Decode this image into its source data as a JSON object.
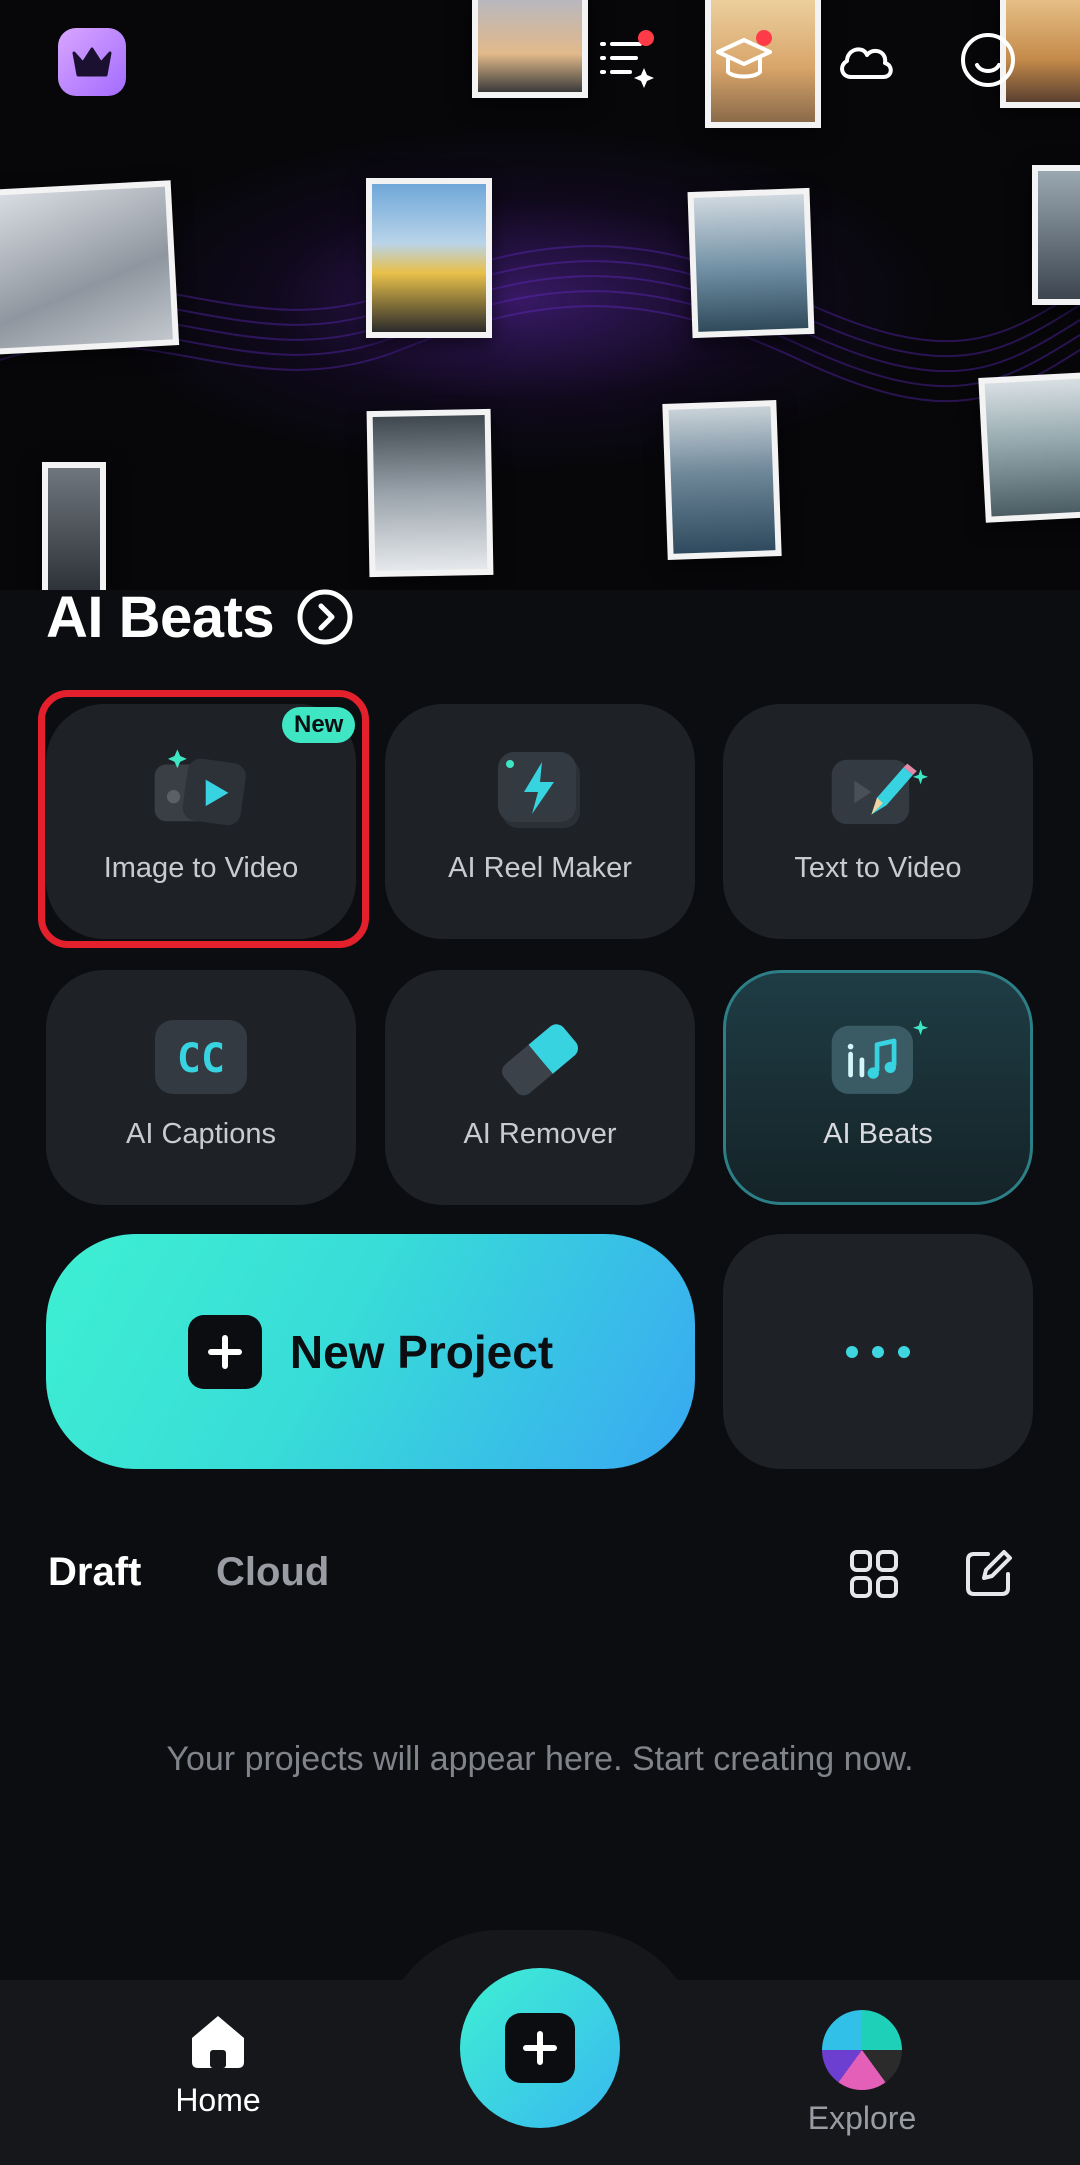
{
  "section": {
    "title": "AI Beats"
  },
  "tools": [
    {
      "label": "Image to Video",
      "badge": "New",
      "icon": "image-to-video-icon"
    },
    {
      "label": "AI Reel Maker",
      "icon": "lightning-icon"
    },
    {
      "label": "Text to Video",
      "icon": "pencil-video-icon"
    },
    {
      "label": "AI Captions",
      "icon": "cc-icon",
      "icon_text": "CC"
    },
    {
      "label": "AI Remover",
      "icon": "eraser-icon"
    },
    {
      "label": "AI Beats",
      "icon": "music-note-icon"
    }
  ],
  "actions": {
    "new_project": "New Project",
    "more": "more-icon"
  },
  "tabs": {
    "draft": "Draft",
    "cloud": "Cloud"
  },
  "empty_message": "Your projects will appear here. Start creating now.",
  "nav": {
    "home": "Home",
    "explore": "Explore"
  },
  "colors": {
    "accent": "#3ee6c4",
    "accent_blue": "#39a8f2",
    "highlight": "#e3202c",
    "notify": "#ff3b47"
  }
}
